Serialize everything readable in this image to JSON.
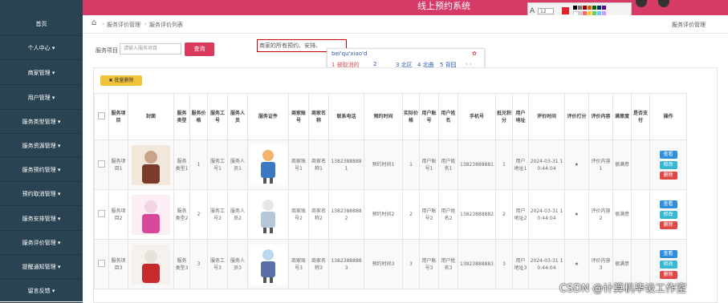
{
  "app": {
    "title": "线上预约系统"
  },
  "sidebar": {
    "items": [
      {
        "label": "首页"
      },
      {
        "label": "个人中心 ▾"
      },
      {
        "label": "商家管理 ▾"
      },
      {
        "label": "用户管理 ▾"
      },
      {
        "label": "服务类型管理 ▾"
      },
      {
        "label": "服务资源管理 ▾"
      },
      {
        "label": "服务预约管理 ▾"
      },
      {
        "label": "预约取消管理 ▾"
      },
      {
        "label": "服务安排管理 ▾"
      },
      {
        "label": "服务评价管理 ▾"
      },
      {
        "label": "提醒通知管理 ▾"
      },
      {
        "label": "留言反馈 ▾"
      }
    ]
  },
  "breadcrumb": {
    "items": [
      "服务评价管理",
      "服务评价列表"
    ],
    "separator": "›",
    "right_title": "服务评价管理"
  },
  "search": {
    "label": "服务项目",
    "placeholder": "请输入服务项目",
    "button": "查询"
  },
  "ime": {
    "composed_text": "商家的所有预约、安排、",
    "pinyin": "bei'qu'xiao'd",
    "candidates": [
      "1 被取消的",
      "2 ",
      "3 北区",
      "4 北曲",
      "5 背囧"
    ]
  },
  "toolbar": {
    "font_size": "12",
    "letter": "A"
  },
  "table": {
    "bulk_delete": "✖ 批量删除",
    "headers": [
      "服务项目",
      "封面",
      "服务类型",
      "服务价格",
      "服务工号",
      "服务人员",
      "服务证件",
      "商家账号",
      "商家名称",
      "联系电话",
      "预约时间",
      "实际价格",
      "用户账号",
      "用户姓名",
      "手机号",
      "抵兑积分",
      "用户地址",
      "评价时间",
      "评价打分",
      "评价内容",
      "满意度",
      "是否支付",
      "操作"
    ],
    "rows": [
      {
        "cells": [
          "服务项目1",
          "",
          "服务类型1",
          "1",
          "服务工号1",
          "服务人员1",
          "",
          "商家账号1",
          "商家名称1",
          "13823888881",
          "预约时间1",
          "1",
          "用户账号1",
          "用户姓名1",
          "13823888881",
          "1",
          "用户地址1",
          "2024-03-31 10:44:04",
          "★",
          "评价内容1",
          "很满意",
          ""
        ]
      },
      {
        "cells": [
          "服务项目2",
          "",
          "服务类型2",
          "2",
          "服务工号2",
          "服务人员2",
          "",
          "商家账号2",
          "商家名称2",
          "13823888882",
          "预约时间2",
          "2",
          "用户账号2",
          "用户姓名2",
          "13823888882",
          "2",
          "用户地址2",
          "2024-03-31 10:44:04",
          "★",
          "评价内容2",
          "很满意",
          ""
        ]
      },
      {
        "cells": [
          "服务项目3",
          "",
          "服务类型3",
          "3",
          "服务工号3",
          "服务人员3",
          "",
          "商家账号3",
          "商家名称3",
          "13823888883",
          "预约时间3",
          "3",
          "用户账号3",
          "用户姓名3",
          "13823888883",
          "3",
          "用户地址3",
          "2024-03-31 10:44:04",
          "★",
          "评价内容3",
          "很满意",
          ""
        ]
      }
    ],
    "actions": {
      "view": "查看",
      "edit": "修改",
      "delete": "删除"
    }
  },
  "watermark": "CSDN @计算机毕设工作室",
  "colors": {
    "brand": "#d63a66",
    "sidebar": "#2a4352",
    "view": "#2f8fdc",
    "edit": "#36b7d4",
    "delete": "#e04848"
  }
}
